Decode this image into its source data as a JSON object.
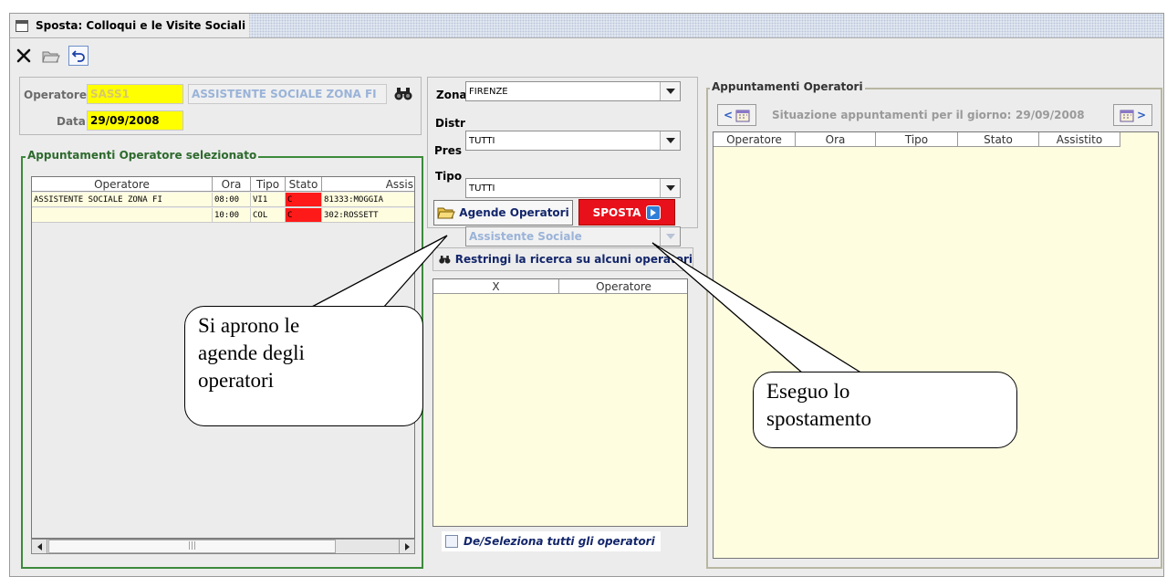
{
  "window": {
    "title": "Sposta: Colloqui e le Visite Sociali"
  },
  "toolbar": {
    "icons": [
      "close-icon",
      "open-folder-icon",
      "undo-icon"
    ]
  },
  "operator_panel": {
    "operatore_label": "Operatore",
    "operatore_code": "SASS1",
    "operatore_name": "ASSISTENTE SOCIALE ZONA FI",
    "data_label": "Data",
    "data_value": "29/09/2008"
  },
  "selected_appointments": {
    "title": "Appuntamenti Operatore selezionato",
    "columns": [
      "Operatore",
      "Ora",
      "Tipo",
      "Stato",
      "Assis"
    ],
    "rows": [
      {
        "operatore": "ASSISTENTE SOCIALE ZONA FI",
        "ora": "08:00",
        "tipo": "VI1",
        "stato": "C",
        "assistito": "81333:MOGGIA"
      },
      {
        "operatore": "",
        "ora": "10:00",
        "tipo": "COL",
        "stato": "C",
        "assistito": "302:ROSSETT"
      }
    ],
    "scroll_grip": "|||"
  },
  "filters": {
    "zona_label": "Zona",
    "zona_value": "FIRENZE",
    "distr_label": "Distr",
    "distr_value": "TUTTI",
    "pres_label": "Pres",
    "pres_value": "TUTTI",
    "tipo_label": "Tipo",
    "tipo_value": "Assistente Sociale"
  },
  "buttons": {
    "agende": "Agende Operatori",
    "sposta": "SPOSTA",
    "restringi": "Restringi la ricerca su alcuni operatori"
  },
  "operator_select": {
    "columns": [
      "X",
      "Operatore"
    ],
    "select_all_label": "De/Seleziona tutti gli operatori"
  },
  "operators_appointments": {
    "title": "Appuntamenti Operatori",
    "situazione_label": "Situazione appuntamenti per il giorno:",
    "situazione_date": "29/09/2008",
    "prev": "<",
    "next": ">",
    "columns": [
      "Operatore",
      "Ora",
      "Tipo",
      "Stato",
      "Assistito"
    ]
  },
  "callouts": {
    "left": "Si aprono le agende degli operatori",
    "right": "Eseguo lo spostamento"
  },
  "colors": {
    "highlight": "#ffff00",
    "state_red": "#ff1a1a",
    "group_green": "#3c8a3c",
    "list_bg": "#fffde0",
    "sposta_bg": "#e8101a"
  }
}
